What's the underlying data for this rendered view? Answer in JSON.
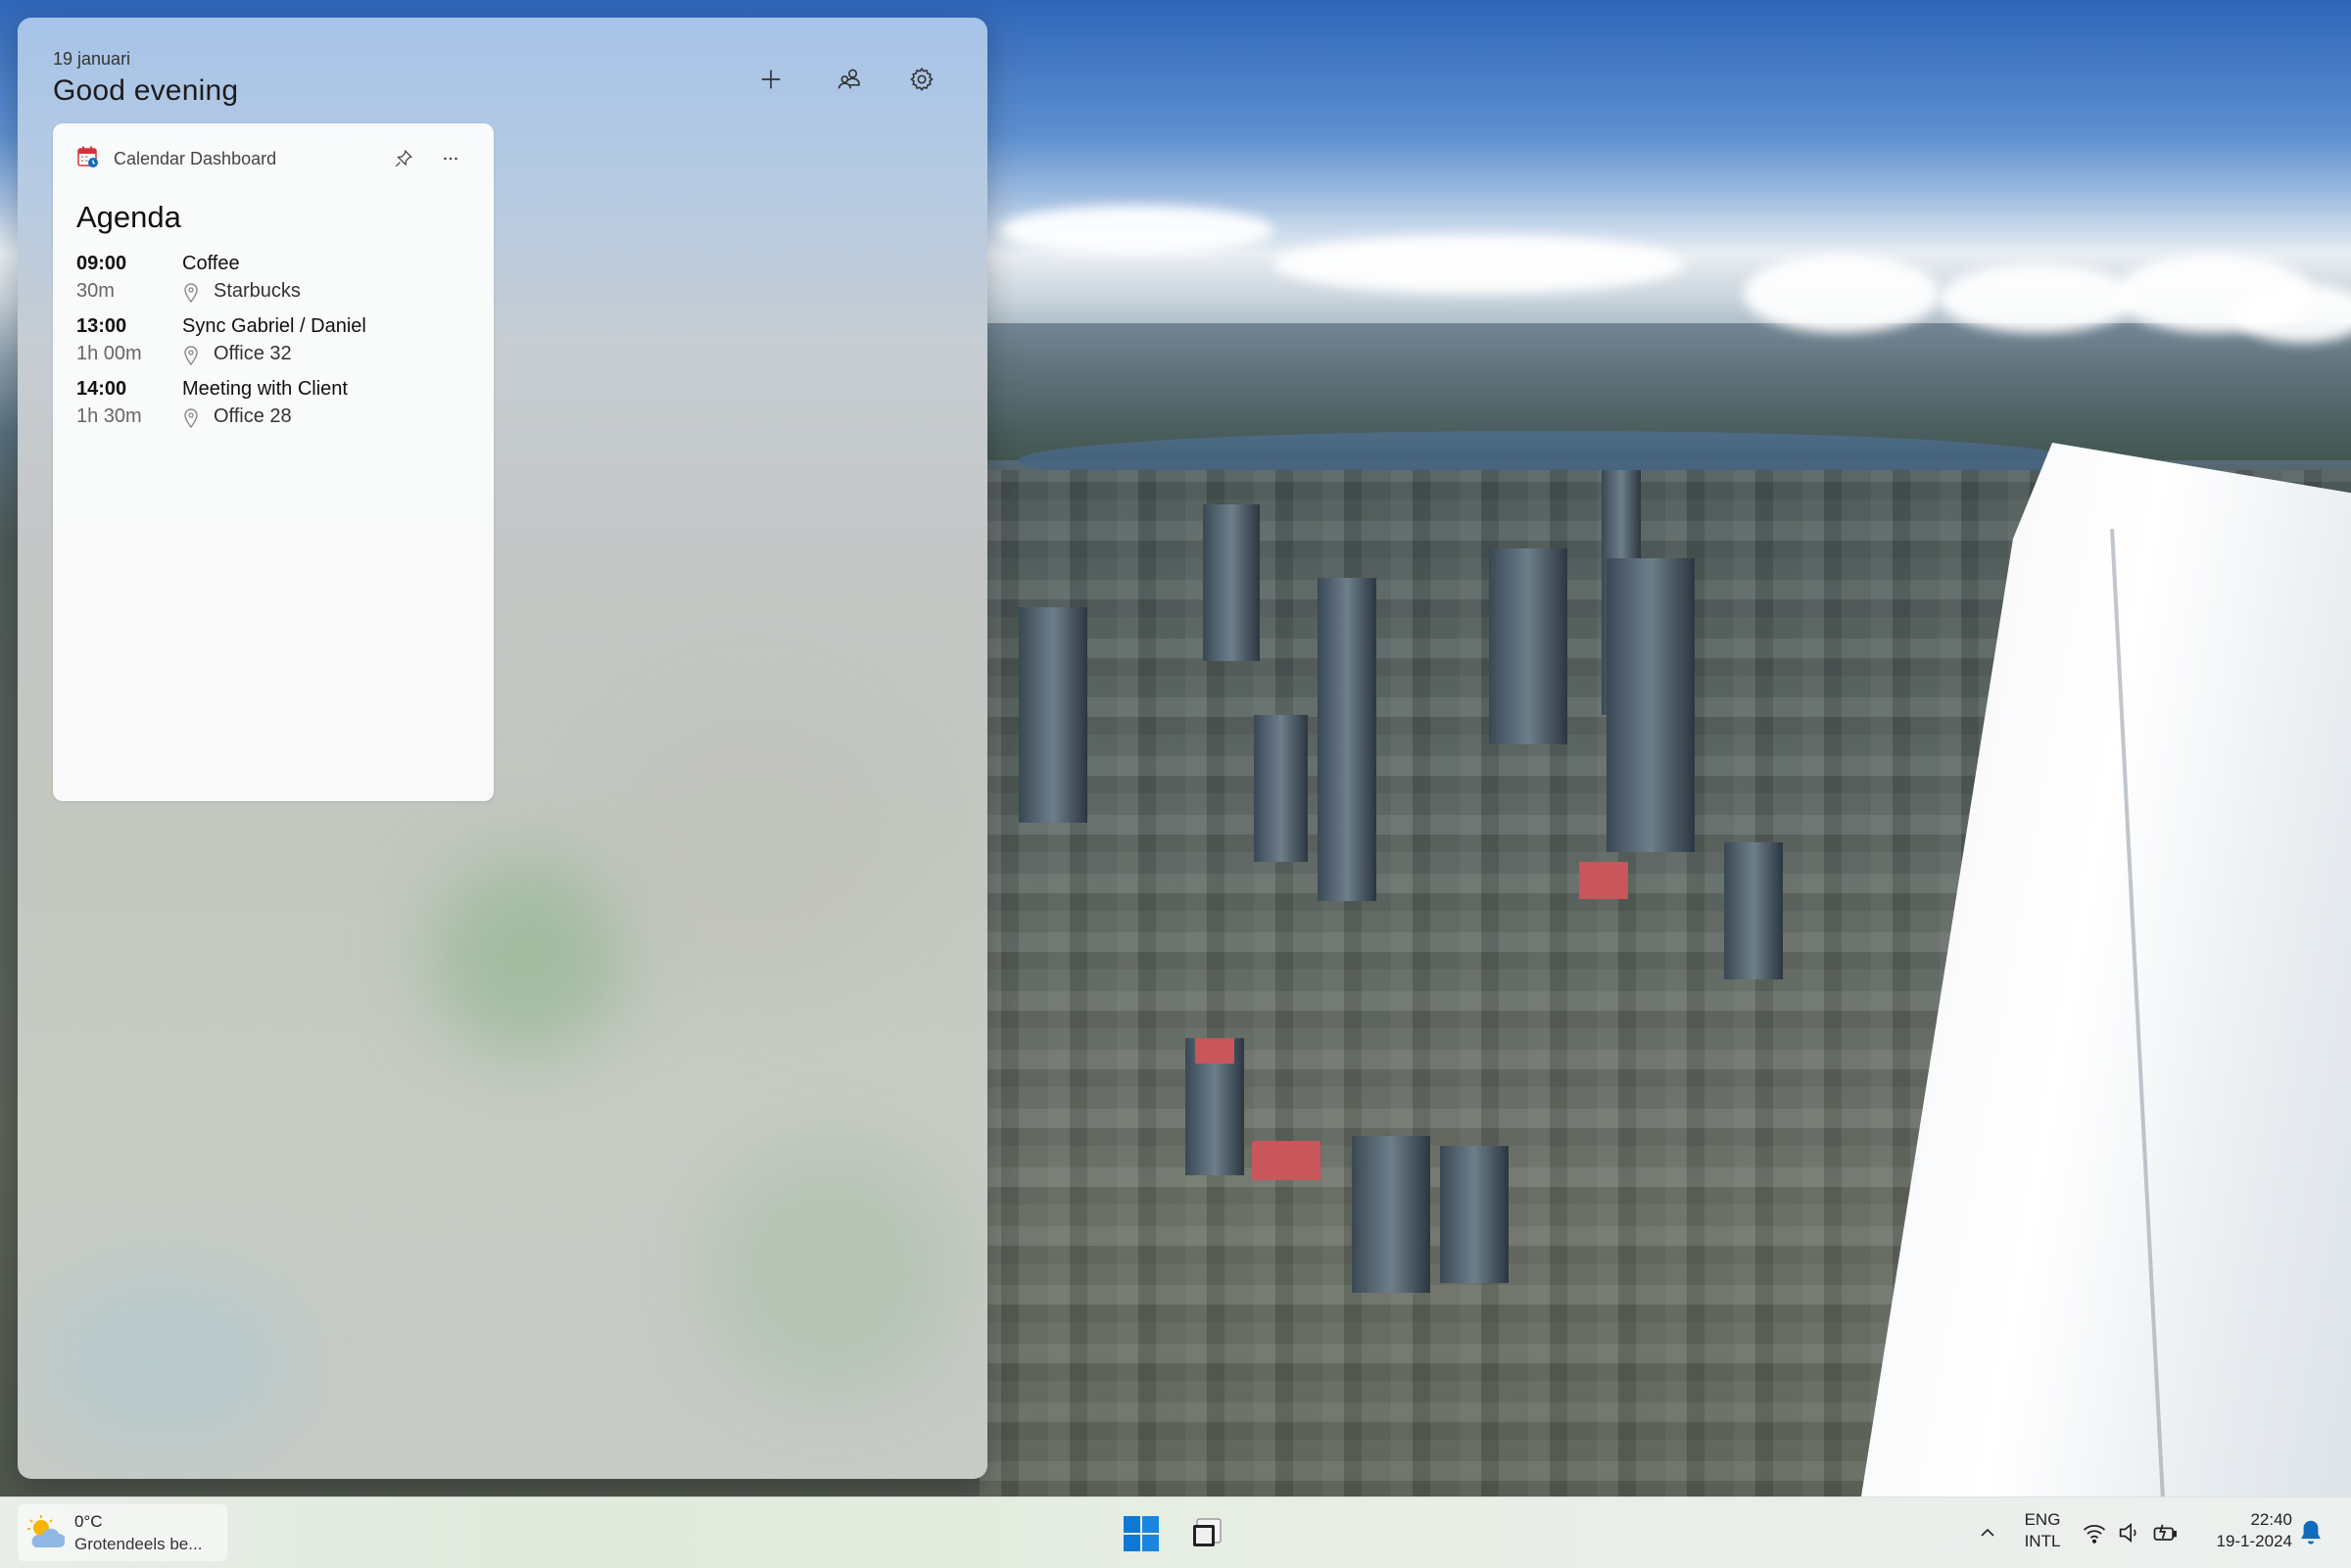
{
  "board": {
    "date": "19 januari",
    "greeting": "Good evening",
    "buttons": [
      {
        "icon": "plus-icon"
      },
      {
        "icon": "people-icon"
      },
      {
        "icon": "gear-icon"
      }
    ]
  },
  "widget": {
    "app_name": "Calendar Dashboard",
    "app_icon": "calendar-icon",
    "pin_icon": "pin-icon",
    "more_icon": "more-icon",
    "title": "Agenda",
    "events": [
      {
        "time": "09:00",
        "duration": "30m",
        "title": "Coffee",
        "location": "Starbucks"
      },
      {
        "time": "13:00",
        "duration": "1h 00m",
        "title": "Sync Gabriel / Daniel",
        "location": "Office 32"
      },
      {
        "time": "14:00",
        "duration": "1h 30m",
        "title": "Meeting with Client",
        "location": "Office 28"
      }
    ]
  },
  "taskbar": {
    "weather": {
      "temp": "0°C",
      "desc": "Grotendeels be...",
      "icon": "partly-cloudy-icon"
    },
    "start_icon": "windows-start-icon",
    "app_icon": "widgets-app-icon",
    "tray": {
      "chevron_icon": "chevron-up-icon",
      "lang_line1": "ENG",
      "lang_line2": "INTL",
      "icons": [
        "wifi-icon",
        "volume-icon",
        "battery-icon"
      ]
    },
    "clock": {
      "time": "22:40",
      "date": "19-1-2024"
    },
    "notification_icon": "bell-icon"
  },
  "colors": {
    "start_blue": "#0067c0",
    "accent": "#0f6cbd"
  }
}
